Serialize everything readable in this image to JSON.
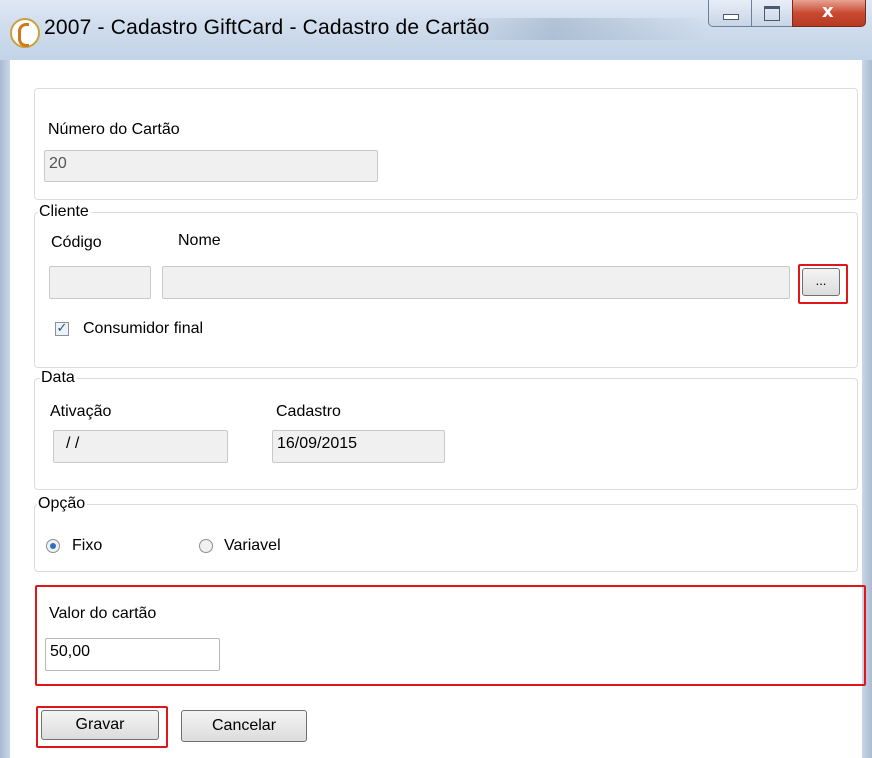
{
  "window": {
    "title": "2007 - Cadastro GiftCard - Cadastro de Cartão",
    "close_glyph": "x"
  },
  "numero": {
    "label": "Número do Cartão",
    "value": "20"
  },
  "cliente": {
    "legend": "Cliente",
    "codigo_label": "Código",
    "nome_label": "Nome",
    "codigo_value": "",
    "nome_value": "",
    "lookup_label": "...",
    "consumidor_label": "Consumidor final",
    "consumidor_checked": true
  },
  "data": {
    "legend": "Data",
    "ativacao_label": "Ativação",
    "ativacao_value": " / /",
    "cadastro_label": "Cadastro",
    "cadastro_value": "16/09/2015"
  },
  "opcao": {
    "legend": "Opção",
    "options": [
      {
        "label": "Fixo",
        "selected": true
      },
      {
        "label": "Variavel",
        "selected": false
      }
    ]
  },
  "valor": {
    "label": "Valor do cartão",
    "value": "50,00"
  },
  "buttons": {
    "save_label": "Gravar",
    "cancel_label": "Cancelar"
  },
  "colors": {
    "highlight": "#e0161b",
    "titlebar": "#cfdcec"
  }
}
